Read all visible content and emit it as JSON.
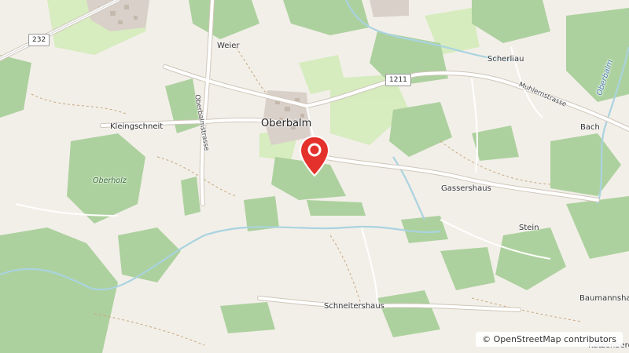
{
  "map": {
    "places": {
      "oberbalm": "Oberbalm",
      "weier": "Weier",
      "kleingschneit": "Kleingschneit",
      "scherliau": "Scherliau",
      "bach": "Bach",
      "gassershaus": "Gassershaus",
      "stein": "Stein",
      "schneitershaus": "Schneitershaus",
      "baumannshaus": "Baumannsha",
      "katzenberg": "Katzenberg"
    },
    "woods": {
      "oberholz": "Oberholz"
    },
    "rivers": {
      "oberbalm": "Oberbalm"
    },
    "streets": {
      "oberbalmstrasse": "Oberbalmstrasse",
      "muhlernstrasse": "Muhlernstrasse"
    },
    "road_shields": {
      "r232": "232",
      "r1211": "1211"
    },
    "marker": {
      "icon": "map-pin-icon",
      "color": "#e4312b"
    },
    "colors": {
      "background": "#f2efe9",
      "forest": "#add19e",
      "meadow": "#cdebb0",
      "water": "#aad3df",
      "road": "#ffffff",
      "settlement": "#d9d0c9"
    }
  },
  "attribution": {
    "text": "© OpenStreetMap contributors"
  }
}
